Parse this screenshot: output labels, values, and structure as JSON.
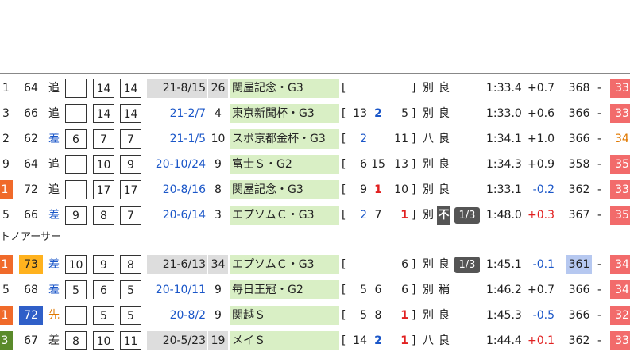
{
  "section_label": "トノアーサー",
  "rows": [
    {
      "num": "1",
      "num_bg": "",
      "rating": "64",
      "rating_bg": "",
      "style": "追",
      "style_color": "",
      "gate": "",
      "field": "14",
      "pos": "14",
      "date": "21-8/15",
      "date_color": "",
      "date_bg": "#dddddd",
      "n": "26",
      "n_bg": "#dddddd",
      "race": "関屋記念・G3",
      "race_bg": "#d9efc5",
      "bracket": "[",
      "p1": "",
      "p1_color": "",
      "p2": "",
      "p2_color": "",
      "p3": "",
      "p3_color": "",
      "close": "]",
      "track": "別",
      "cond": "良",
      "pill": "",
      "pill_bg": "",
      "time": "1:33.4",
      "diff": "+0.7",
      "diff_color": "",
      "last": "368",
      "last_bg": "",
      "dash": "-",
      "end": "33",
      "end_bg": "#f26b6b",
      "end_color": "#ffffff"
    },
    {
      "num": "3",
      "num_bg": "",
      "rating": "66",
      "rating_bg": "",
      "style": "追",
      "style_color": "",
      "gate": "",
      "field": "14",
      "pos": "14",
      "date": "21-2/7",
      "date_color": "blue",
      "date_bg": "",
      "n": "4",
      "n_bg": "",
      "race": "東京新聞杯・G3",
      "race_bg": "#d9efc5",
      "bracket": "[",
      "p1": "13",
      "p1_color": "",
      "p2": "2",
      "p2_color": "blue",
      "p3": "5",
      "p3_color": "",
      "close": "]",
      "track": "別",
      "cond": "良",
      "pill": "",
      "pill_bg": "",
      "time": "1:33.0",
      "diff": "+0.6",
      "diff_color": "",
      "last": "366",
      "last_bg": "",
      "dash": "-",
      "end": "33",
      "end_bg": "#f26b6b",
      "end_color": "#ffffff"
    },
    {
      "num": "2",
      "num_bg": "",
      "rating": "62",
      "rating_bg": "",
      "style": "差",
      "style_color": "blue",
      "gate": "6",
      "field": "7",
      "pos": "7",
      "date": "21-1/5",
      "date_color": "blue",
      "date_bg": "",
      "n": "10",
      "n_bg": "",
      "race": "スポ京都金杯・G3",
      "race_bg": "#d9efc5",
      "bracket": "[",
      "p1": "2",
      "p1_color": "blue",
      "p2": "",
      "p2_color": "",
      "p3": "11",
      "p3_color": "",
      "close": "]",
      "track": "八",
      "cond": "良",
      "pill": "",
      "pill_bg": "",
      "time": "1:34.1",
      "diff": "+1.0",
      "diff_color": "",
      "last": "366",
      "last_bg": "",
      "dash": "-",
      "end": "34",
      "end_bg": "",
      "end_color": "#e07800"
    },
    {
      "num": "9",
      "num_bg": "",
      "rating": "64",
      "rating_bg": "",
      "style": "追",
      "style_color": "",
      "gate": "",
      "field": "10",
      "pos": "9",
      "date": "20-10/24",
      "date_color": "blue",
      "date_bg": "",
      "n": "9",
      "n_bg": "",
      "race": "富士Ｓ・G2",
      "race_bg": "#d9efc5",
      "bracket": "[",
      "p1": "6",
      "p1_color": "",
      "p2": "15",
      "p2_color": "",
      "p3": "13",
      "p3_color": "",
      "close": "]",
      "track": "別",
      "cond": "良",
      "pill": "",
      "pill_bg": "",
      "time": "1:34.3",
      "diff": "+0.9",
      "diff_color": "",
      "last": "358",
      "last_bg": "",
      "dash": "-",
      "end": "35",
      "end_bg": "#f26b6b",
      "end_color": "#ffffff"
    },
    {
      "num": "1",
      "num_bg": "#f06a2a",
      "rating": "72",
      "rating_bg": "",
      "style": "追",
      "style_color": "",
      "gate": "",
      "field": "17",
      "pos": "17",
      "date": "20-8/16",
      "date_color": "blue",
      "date_bg": "",
      "n": "8",
      "n_bg": "",
      "race": "関屋記念・G3",
      "race_bg": "#d9efc5",
      "bracket": "[",
      "p1": "9",
      "p1_color": "",
      "p2": "1",
      "p2_color": "red",
      "p3": "10",
      "p3_color": "",
      "close": "]",
      "track": "別",
      "cond": "良",
      "pill": "",
      "pill_bg": "",
      "time": "1:33.1",
      "diff": "-0.2",
      "diff_color": "blue",
      "last": "362",
      "last_bg": "",
      "dash": "-",
      "end": "33",
      "end_bg": "#f26b6b",
      "end_color": "#ffffff"
    },
    {
      "num": "5",
      "num_bg": "",
      "rating": "66",
      "rating_bg": "",
      "style": "差",
      "style_color": "blue",
      "gate": "9",
      "field": "8",
      "pos": "7",
      "date": "20-6/14",
      "date_color": "blue",
      "date_bg": "",
      "n": "3",
      "n_bg": "",
      "race": "エプソムＣ・G3",
      "race_bg": "#d9efc5",
      "bracket": "[",
      "p1": "2",
      "p1_color": "blue",
      "p2": "7",
      "p2_color": "",
      "p3": "1",
      "p3_color": "red",
      "close": "]",
      "track": "別",
      "cond": "不",
      "cond_bg": "#555555",
      "pill": "1/3",
      "pill_bg": "#555555",
      "time": "1:48.0",
      "diff": "+0.3",
      "diff_color": "red",
      "last": "367",
      "last_bg": "",
      "dash": "-",
      "end": "35",
      "end_bg": "#f26b6b",
      "end_color": "#ffffff"
    },
    {
      "num": "1",
      "num_bg": "#f06a2a",
      "rating": "73",
      "rating_bg": "#ffb21e",
      "style": "差",
      "style_color": "blue",
      "gate": "10",
      "field": "9",
      "pos": "8",
      "date": "21-6/13",
      "date_color": "",
      "date_bg": "#dddddd",
      "n": "34",
      "n_bg": "#dddddd",
      "race": "エプソムＣ・G3",
      "race_bg": "#d9efc5",
      "bracket": "[",
      "p1": "",
      "p1_color": "",
      "p2": "",
      "p2_color": "",
      "p3": "6",
      "p3_color": "",
      "close": "]",
      "track": "別",
      "cond": "良",
      "pill": "1/3",
      "pill_bg": "#555555",
      "time": "1:45.1",
      "diff": "-0.1",
      "diff_color": "blue",
      "last": "361",
      "last_bg": "#b6c8f0",
      "dash": "-",
      "end": "34",
      "end_bg": "#f26b6b",
      "end_color": "#ffffff"
    },
    {
      "num": "5",
      "num_bg": "",
      "rating": "68",
      "rating_bg": "",
      "style": "差",
      "style_color": "blue",
      "gate": "5",
      "field": "6",
      "pos": "5",
      "date": "20-10/11",
      "date_color": "blue",
      "date_bg": "",
      "n": "9",
      "n_bg": "",
      "race": "毎日王冠・G2",
      "race_bg": "#d9efc5",
      "bracket": "[",
      "p1": "5",
      "p1_color": "",
      "p2": "6",
      "p2_color": "",
      "p3": "6",
      "p3_color": "",
      "close": "]",
      "track": "別",
      "cond": "稍",
      "pill": "",
      "pill_bg": "",
      "time": "1:46.2",
      "diff": "+0.7",
      "diff_color": "",
      "last": "366",
      "last_bg": "",
      "dash": "-",
      "end": "34",
      "end_bg": "#f26b6b",
      "end_color": "#ffffff"
    },
    {
      "num": "1",
      "num_bg": "#f06a2a",
      "rating": "72",
      "rating_bg": "#2f5fc8",
      "style": "先",
      "style_color": "orange",
      "gate": "",
      "field": "5",
      "pos": "5",
      "date": "20-8/2",
      "date_color": "blue",
      "date_bg": "",
      "n": "9",
      "n_bg": "",
      "race": "関越Ｓ",
      "race_bg": "#d9efc5",
      "bracket": "[",
      "p1": "5",
      "p1_color": "",
      "p2": "8",
      "p2_color": "",
      "p3": "1",
      "p3_color": "red",
      "close": "]",
      "track": "別",
      "cond": "良",
      "pill": "",
      "pill_bg": "",
      "time": "1:45.3",
      "diff": "-0.5",
      "diff_color": "blue",
      "last": "366",
      "last_bg": "",
      "dash": "-",
      "end": "32",
      "end_bg": "#f26b6b",
      "end_color": "#ffffff"
    },
    {
      "num": "3",
      "num_bg": "#5a8a2a",
      "rating": "67",
      "rating_bg": "",
      "style": "差",
      "style_color": "",
      "gate": "8",
      "field": "10",
      "pos": "11",
      "date": "20-5/23",
      "date_color": "",
      "date_bg": "#dddddd",
      "n": "19",
      "n_bg": "#dddddd",
      "race": "メイＳ",
      "race_bg": "#d9efc5",
      "bracket": "[",
      "p1": "14",
      "p1_color": "",
      "p2": "2",
      "p2_color": "blue",
      "p3": "1",
      "p3_color": "red",
      "close": "]",
      "track": "八",
      "cond": "良",
      "pill": "",
      "pill_bg": "",
      "time": "1:44.4",
      "diff": "+0.1",
      "diff_color": "red",
      "last": "362",
      "last_bg": "",
      "dash": "-",
      "end": "33",
      "end_bg": "#f26b6b",
      "end_color": "#ffffff"
    }
  ]
}
